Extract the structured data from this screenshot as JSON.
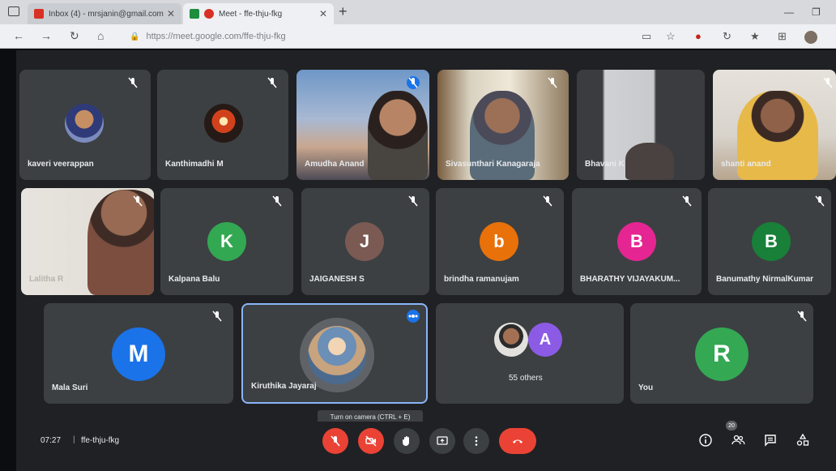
{
  "browser": {
    "tabs": [
      {
        "label": "Inbox (4) - mrsjanin@gmail.com",
        "favicon_color": "#d93025"
      },
      {
        "label": "Meet - ffe-thju-fkg",
        "favicon_color": "#1e8e3e"
      }
    ],
    "address": "https://meet.google.com/ffe-thju-fkg"
  },
  "tiles": [
    {
      "name": "kaveri veerappan",
      "kind": "photo-avatar",
      "muted": true
    },
    {
      "name": "Kanthimadhi M",
      "kind": "photo-avatar",
      "muted": true
    },
    {
      "name": "Amudha Anand",
      "kind": "video",
      "muted": true
    },
    {
      "name": "Sivasunthari Kanagaraja",
      "kind": "video",
      "muted": true
    },
    {
      "name": "Bhavani K",
      "kind": "video",
      "muted": false
    },
    {
      "name": "shanti anand",
      "kind": "video",
      "muted": true
    },
    {
      "name": "Lalitha R",
      "kind": "video",
      "muted": true
    },
    {
      "name": "Kalpana Balu",
      "kind": "letter",
      "letter": "K",
      "color": "#33a852",
      "muted": true
    },
    {
      "name": "JAIGANESH S",
      "kind": "letter",
      "letter": "J",
      "color": "#7a5a52",
      "muted": true
    },
    {
      "name": "brindha ramanujam",
      "kind": "letter",
      "letter": "b",
      "color": "#e8710a",
      "muted": true
    },
    {
      "name": "BHARATHY VIJAYAKUM...",
      "kind": "letter",
      "letter": "B",
      "color": "#e52592",
      "muted": true
    },
    {
      "name": "Banumathy NirmalKumar",
      "kind": "letter",
      "letter": "B",
      "color": "#188038",
      "muted": true
    },
    {
      "name": "Mala Suri",
      "kind": "letter",
      "letter": "M",
      "color": "#1a73e8",
      "muted": true
    },
    {
      "name": "Kiruthika Jayaraj",
      "kind": "photo-avatar",
      "muted": false,
      "speaking": true
    },
    {
      "name": "55 others",
      "kind": "others",
      "letter": "A",
      "color": "#8c5be5",
      "muted": false
    },
    {
      "name": "You",
      "kind": "letter",
      "letter": "R",
      "color": "#34a853",
      "muted": true
    }
  ],
  "bottom": {
    "time": "07:27",
    "code": "ffe-thju-fkg",
    "tooltip": "Turn on camera (CTRL + E)",
    "people_badge": "20"
  },
  "colors": {
    "end_call": "#ea4335",
    "muted_btn": "#ea4335",
    "accent": "#8ab4f8"
  }
}
